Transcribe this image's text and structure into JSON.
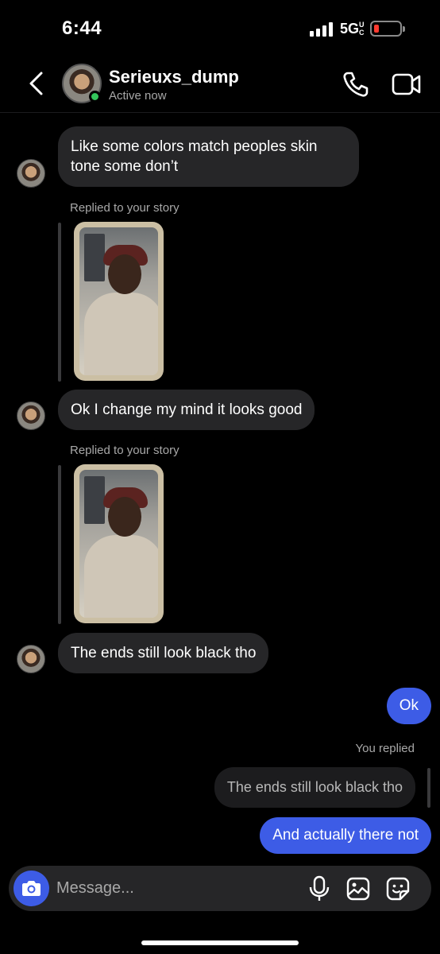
{
  "status_bar": {
    "time": "6:44",
    "network": "5G",
    "network_sup": "UC",
    "battery_color": "#ff3b30"
  },
  "header": {
    "contact_name": "Serieuxs_dump",
    "status": "Active now",
    "icons": [
      "back-chevron-icon",
      "phone-icon",
      "video-camera-icon"
    ]
  },
  "messages": {
    "m1": "Like some colors match peoples skin tone some don’t",
    "reply1_label": "Replied to your story",
    "m2": "Ok I change my mind it looks good",
    "reply2_label": "Replied to your story",
    "m3": "The ends still look black tho",
    "out1": "Ok",
    "you_replied_label": "You replied",
    "quoted": "The ends still look black tho",
    "out2": "And actually there not"
  },
  "composer": {
    "placeholder": "Message...",
    "icons": [
      "camera-icon",
      "microphone-icon",
      "gallery-icon",
      "sticker-icon"
    ]
  },
  "colors": {
    "outgoing_bubble": "#3d5ce6",
    "incoming_bubble": "#262628",
    "active_dot": "#33c65b"
  }
}
